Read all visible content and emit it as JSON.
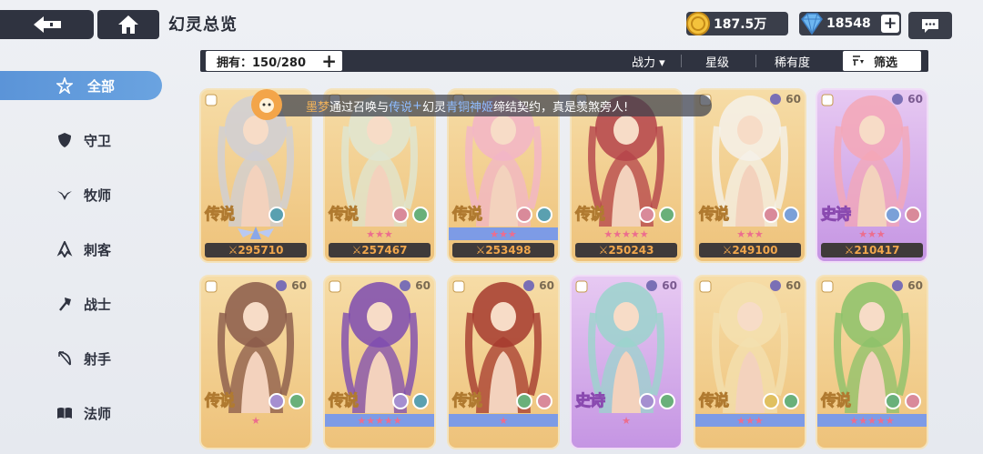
{
  "header": {
    "title": "幻灵总览",
    "gold": "187.5万",
    "gems": "18548",
    "plus": "+"
  },
  "filterbar": {
    "owned_label": "拥有：150/280",
    "plus": "+",
    "sort_power": "战力 ▾",
    "sort_star": "星级",
    "sort_rarity": "稀有度",
    "filter": "筛选"
  },
  "sidebar": {
    "items": [
      {
        "label": "全部",
        "icon": "star-burst-icon",
        "active": true
      },
      {
        "label": "守卫",
        "icon": "shield-icon"
      },
      {
        "label": "牧师",
        "icon": "wing-heart-icon"
      },
      {
        "label": "刺客",
        "icon": "blade-icon"
      },
      {
        "label": "战士",
        "icon": "axe-icon"
      },
      {
        "label": "射手",
        "icon": "bow-icon"
      },
      {
        "label": "法师",
        "icon": "book-icon"
      }
    ]
  },
  "notice": {
    "name": "墨梦",
    "text1": "通过召唤与",
    "rarity": "传说",
    "text2": "幻灵",
    "hero": "青铜神姬",
    "text3": "缔结契约，真是羡煞旁人!"
  },
  "cards": [
    {
      "rarity": "传说",
      "power": "295710",
      "stars": "",
      "level": "",
      "theme": "legend",
      "elements": [
        "#5aa0b0"
      ],
      "color": "#cfcfd6"
    },
    {
      "rarity": "传说",
      "power": "257467",
      "stars": "★★★",
      "level": "",
      "theme": "legend",
      "elements": [
        "#d98a9a",
        "#6ab07a"
      ],
      "color": "#dfe6d2"
    },
    {
      "rarity": "传说",
      "power": "253498",
      "stars": "★★★",
      "level": "",
      "theme": "legend",
      "stars_blue": true,
      "elements": [
        "#d98a9a",
        "#5aa0b0"
      ],
      "color": "#f2b5c8"
    },
    {
      "rarity": "传说",
      "power": "250243",
      "stars": "★★★★★",
      "level": "",
      "theme": "legend",
      "elements": [
        "#d98a9a",
        "#6ab07a"
      ],
      "color": "#b4434a"
    },
    {
      "rarity": "传说",
      "power": "249100",
      "stars": "★★★",
      "level": "60",
      "theme": "legend",
      "elements": [
        "#d98a9a",
        "#7aa0d8"
      ],
      "color": "#f4f1ea"
    },
    {
      "rarity": "史诗",
      "power": "210417",
      "stars": "★★★",
      "level": "60",
      "theme": "epic",
      "elements": [
        "#7aa0d8",
        "#d98a9a"
      ],
      "color": "#f4a7b6"
    },
    {
      "rarity": "传说",
      "power": "",
      "stars": "★",
      "level": "60",
      "theme": "legend",
      "elements": [
        "#a58fd0",
        "#6ab07a"
      ],
      "color": "#8a5a4a"
    },
    {
      "rarity": "传说",
      "power": "",
      "stars": "★★★★★",
      "level": "60",
      "theme": "legend",
      "stars_blue": true,
      "elements": [
        "#a58fd0",
        "#5aa0b0"
      ],
      "color": "#7d4bb0"
    },
    {
      "rarity": "传说",
      "power": "",
      "stars": "★",
      "level": "60",
      "theme": "legend",
      "stars_blue": true,
      "elements": [
        "#6ab07a",
        "#d98a9a"
      ],
      "color": "#a53a2e"
    },
    {
      "rarity": "史诗",
      "power": "",
      "stars": "★",
      "level": "60",
      "theme": "epic",
      "elements": [
        "#a58fd0",
        "#6ab07a"
      ],
      "color": "#9bd4cc"
    },
    {
      "rarity": "传说",
      "power": "",
      "stars": "★★★",
      "level": "60",
      "theme": "legend",
      "stars_blue": true,
      "elements": [
        "#e0c060",
        "#6ab07a"
      ],
      "color": "#f3e0b0"
    },
    {
      "rarity": "传说",
      "power": "",
      "stars": "★★★★★",
      "level": "60",
      "theme": "legend",
      "stars_blue": true,
      "elements": [
        "#6ab07a",
        "#d98a9a"
      ],
      "color": "#8cc26a"
    }
  ]
}
